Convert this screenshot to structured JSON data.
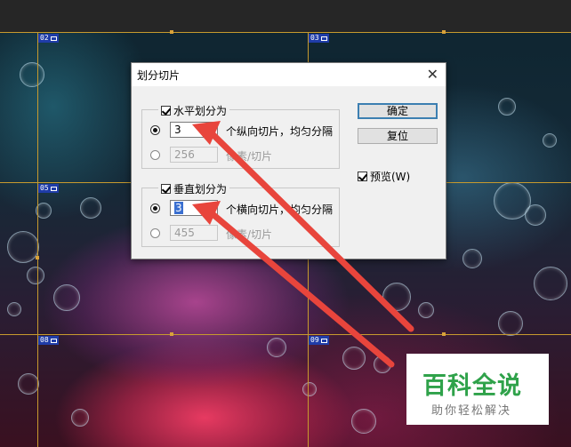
{
  "dialog": {
    "title": "划分切片",
    "close_glyph": "✕",
    "horizontal": {
      "legend": "水平划分为",
      "checked": true,
      "count_value": "3",
      "count_suffix": "个纵向切片，均匀分隔",
      "pixel_value": "256",
      "pixel_suffix": "像素/切片"
    },
    "vertical": {
      "legend": "垂直划分为",
      "checked": true,
      "count_value": "3",
      "count_suffix": "个横向切片，均匀分隔",
      "pixel_value": "455",
      "pixel_suffix": "像素/切片"
    },
    "ok_label": "确定",
    "reset_label": "复位",
    "preview_label": "预览(W)",
    "preview_checked": true
  },
  "slices": [
    {
      "label": "02"
    },
    {
      "label": "03"
    },
    {
      "label": "05"
    },
    {
      "label": "08"
    },
    {
      "label": "09"
    }
  ],
  "watermark": {
    "main": "百科全说",
    "sub": "助你轻松解决"
  },
  "colors": {
    "guide": "#c79a2e",
    "slice_tag": "#1f3ca8",
    "arrow": "#e8453c",
    "watermark_green": "#2fa24a"
  }
}
